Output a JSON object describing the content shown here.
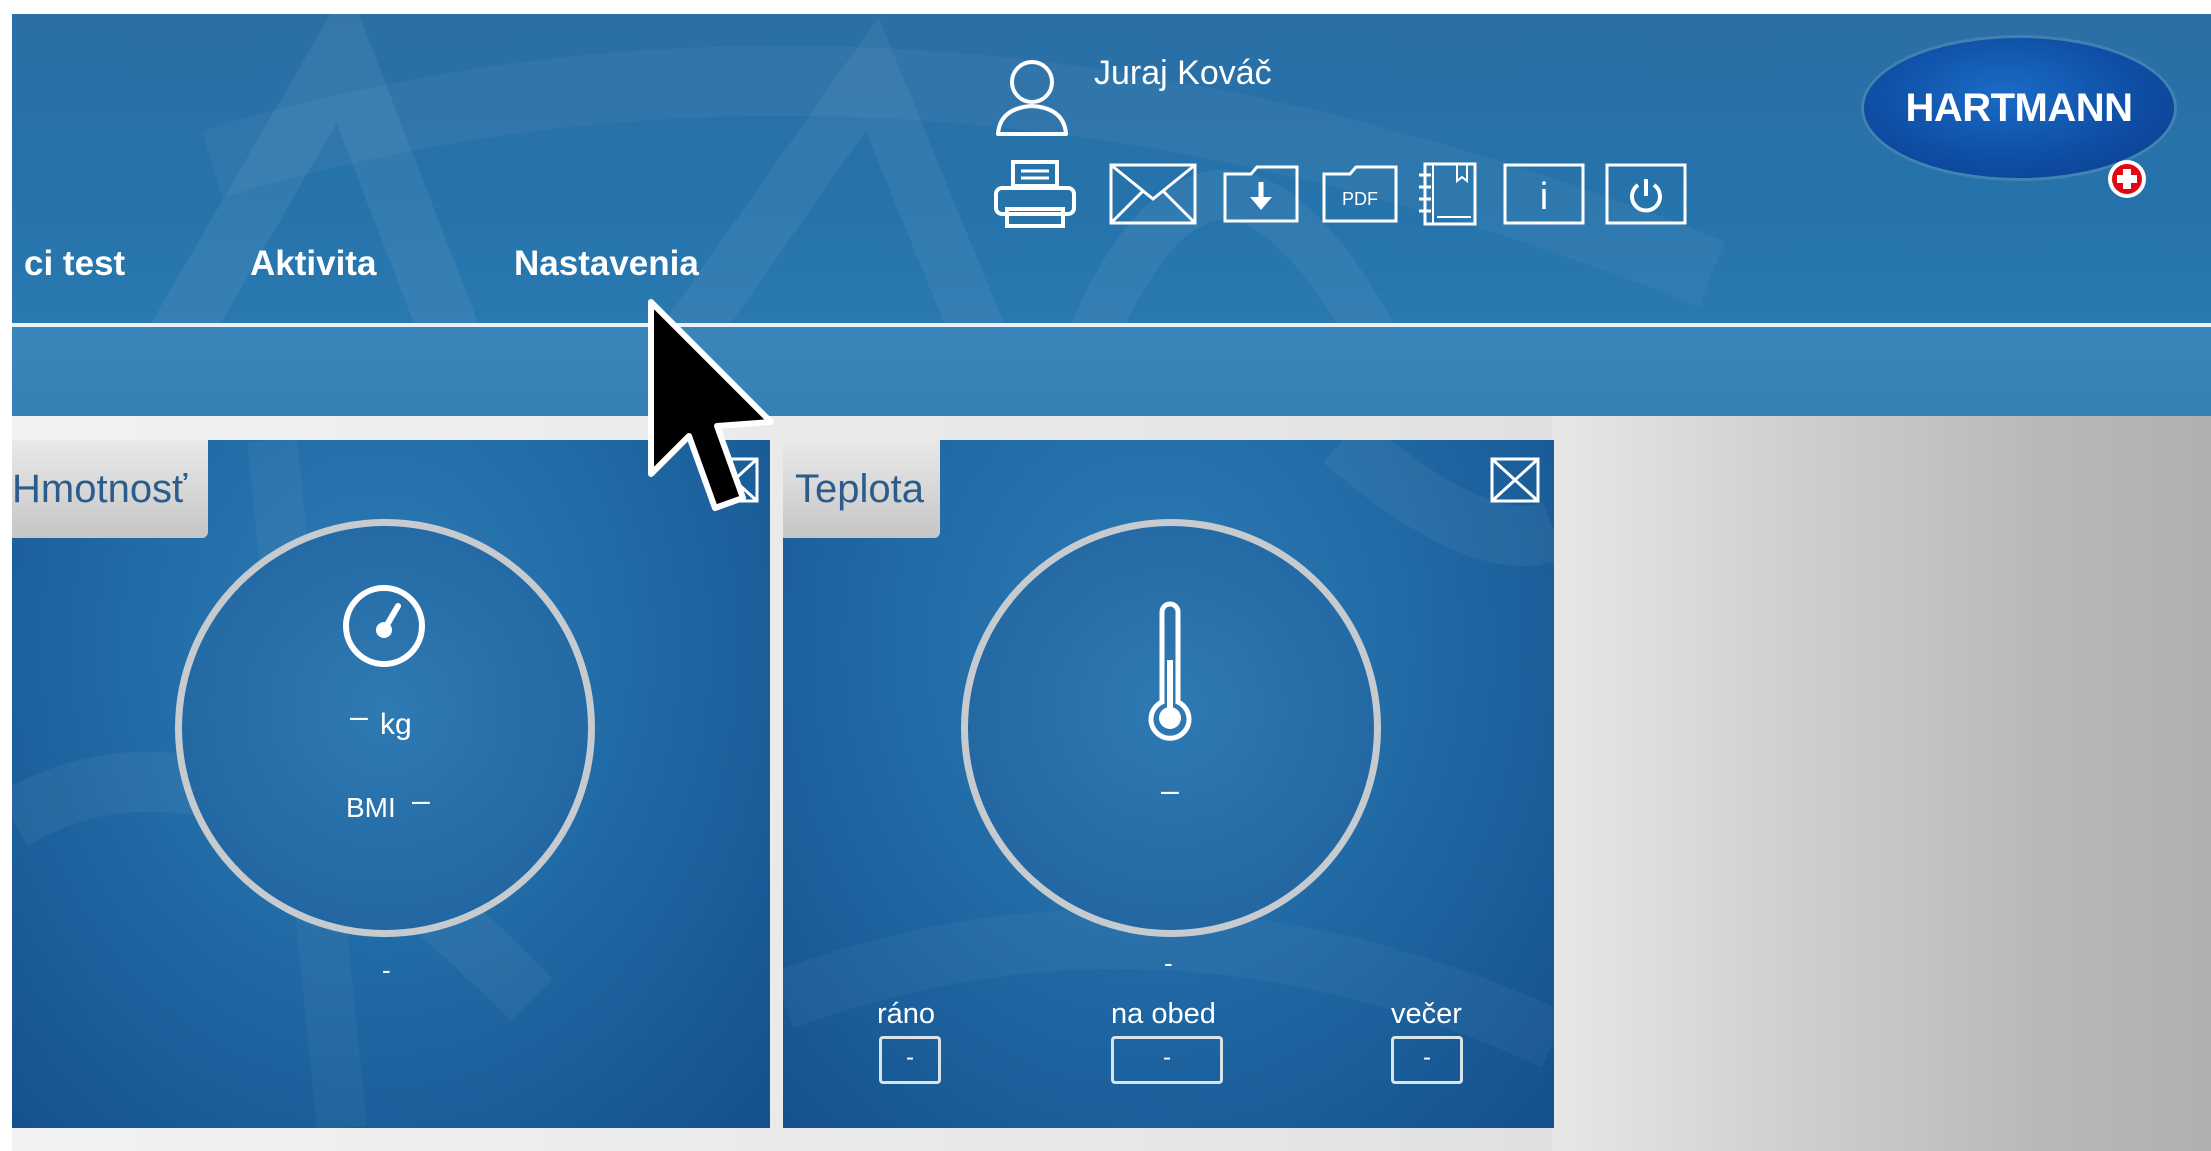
{
  "user": {
    "name": "Juraj Kováč",
    "icon": "user-icon"
  },
  "toolbar": {
    "buttons": [
      {
        "name": "print-icon"
      },
      {
        "name": "mail-icon"
      },
      {
        "name": "download-icon"
      },
      {
        "name": "pdf-icon",
        "label": "PDF"
      },
      {
        "name": "notebook-icon"
      },
      {
        "name": "info-icon",
        "label": "i"
      },
      {
        "name": "power-icon"
      }
    ]
  },
  "logo": {
    "text": "HARTMANN"
  },
  "nav": {
    "items": [
      {
        "label": "ci test"
      },
      {
        "label": "Aktivita"
      },
      {
        "label": "Nastavenia"
      }
    ]
  },
  "panels": {
    "weight": {
      "title": "Hmotnosť",
      "icon": "scale-gauge-icon",
      "value": "–",
      "unit": "kg",
      "bmi_label": "BMI",
      "bmi_value": "–",
      "footer": "-"
    },
    "temperature": {
      "title": "Teplota",
      "icon": "thermometer-icon",
      "value": "–",
      "footer": "-",
      "slots": [
        {
          "label": "ráno",
          "value": "-"
        },
        {
          "label": "na obed",
          "value": "-"
        },
        {
          "label": "večer",
          "value": "-"
        }
      ]
    }
  },
  "colors": {
    "header_blue": "#2673ab",
    "panel_blue": "#226da8",
    "tab_text": "#2b5c8c",
    "logo_blue": "#0e4ea5",
    "logo_red": "#e30613"
  }
}
